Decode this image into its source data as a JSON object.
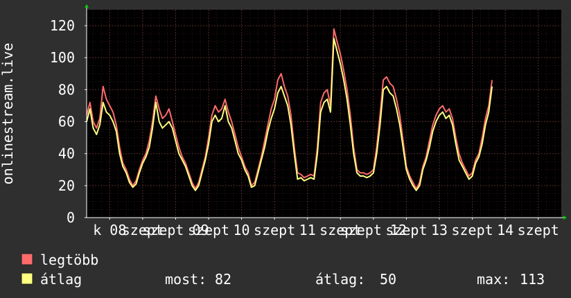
{
  "chart_data": {
    "type": "line",
    "ylabel": "onlinestream.live",
    "ylim": [
      0,
      130
    ],
    "yticks": [
      0,
      20,
      40,
      60,
      80,
      100,
      120
    ],
    "x_tick_labels": [
      "k 08",
      "szept",
      "szept 09",
      "szept",
      "10",
      "szept",
      "11",
      "szept",
      "szept 12",
      "szept",
      "13",
      "szept",
      "14",
      "szept"
    ],
    "x_tick_positions": [
      0,
      0.5,
      1.0,
      1.5,
      2.0,
      2.5,
      3.0,
      3.5,
      4.0,
      4.5,
      5.0,
      5.5,
      6.0,
      6.5
    ],
    "xlim": [
      -0.35,
      6.85
    ],
    "grid": true,
    "colors": {
      "background": "#2f2f2f",
      "canvas": "#000000",
      "grid": "#5a2a2a",
      "axis": "#ffffff",
      "max_series": "#ff6b6b",
      "avg_series": "#ffff80",
      "arrow": "#00cc00"
    },
    "x": [
      -0.35,
      -0.3,
      -0.25,
      -0.2,
      -0.15,
      -0.1,
      -0.05,
      0.0,
      0.05,
      0.1,
      0.15,
      0.2,
      0.25,
      0.3,
      0.35,
      0.4,
      0.45,
      0.5,
      0.55,
      0.6,
      0.65,
      0.7,
      0.75,
      0.8,
      0.85,
      0.9,
      0.95,
      1.0,
      1.05,
      1.1,
      1.15,
      1.2,
      1.25,
      1.3,
      1.35,
      1.4,
      1.45,
      1.5,
      1.55,
      1.6,
      1.65,
      1.7,
      1.75,
      1.8,
      1.85,
      1.9,
      1.95,
      2.0,
      2.05,
      2.1,
      2.15,
      2.2,
      2.25,
      2.3,
      2.35,
      2.4,
      2.45,
      2.5,
      2.55,
      2.6,
      2.65,
      2.7,
      2.75,
      2.8,
      2.85,
      2.9,
      2.95,
      3.0,
      3.05,
      3.1,
      3.15,
      3.2,
      3.25,
      3.3,
      3.35,
      3.4,
      3.45,
      3.5,
      3.55,
      3.6,
      3.65,
      3.7,
      3.75,
      3.8,
      3.85,
      3.9,
      3.95,
      4.0,
      4.05,
      4.1,
      4.15,
      4.2,
      4.25,
      4.3,
      4.35,
      4.4,
      4.45,
      4.5,
      4.55,
      4.6,
      4.65,
      4.7,
      4.75,
      4.8,
      4.85,
      4.9,
      4.95,
      5.0,
      5.05,
      5.1,
      5.15,
      5.2,
      5.25,
      5.3,
      5.35,
      5.4,
      5.45,
      5.5,
      5.55,
      5.6,
      5.65,
      5.7,
      5.75,
      5.8,
      5.85,
      5.9,
      5.95,
      6.0,
      6.05,
      6.1,
      6.15,
      6.2,
      6.25,
      6.3,
      6.35,
      6.4,
      6.45,
      6.5,
      6.55,
      6.6,
      6.65,
      6.7,
      6.75,
      6.8,
      6.85
    ],
    "series": [
      {
        "name": "legtöbb",
        "values": [
          64,
          72,
          60,
          56,
          62,
          82,
          74,
          70,
          66,
          58,
          44,
          34,
          30,
          24,
          20,
          23,
          30,
          36,
          40,
          48,
          60,
          76,
          68,
          62,
          64,
          68,
          60,
          52,
          44,
          38,
          34,
          28,
          22,
          18,
          22,
          30,
          38,
          50,
          64,
          70,
          66,
          68,
          74,
          66,
          60,
          52,
          44,
          38,
          32,
          28,
          20,
          22,
          30,
          38,
          48,
          58,
          68,
          74,
          86,
          90,
          82,
          76,
          64,
          44,
          28,
          27,
          25,
          26,
          27,
          26,
          44,
          72,
          78,
          80,
          70,
          118,
          110,
          102,
          92,
          80,
          64,
          44,
          30,
          28,
          28,
          27,
          28,
          30,
          44,
          64,
          86,
          88,
          84,
          82,
          74,
          64,
          48,
          32,
          26,
          22,
          18,
          22,
          32,
          38,
          48,
          58,
          64,
          68,
          70,
          66,
          68,
          62,
          50,
          40,
          34,
          30,
          26,
          28,
          36,
          40,
          50,
          62,
          70,
          86
        ],
        "sample_note": "shown"
      },
      {
        "name": "átlag",
        "values": [
          60,
          68,
          56,
          52,
          58,
          72,
          66,
          64,
          60,
          54,
          40,
          32,
          28,
          22,
          19,
          21,
          28,
          34,
          38,
          44,
          56,
          72,
          60,
          56,
          58,
          60,
          56,
          48,
          40,
          36,
          32,
          26,
          20,
          17,
          20,
          28,
          36,
          46,
          60,
          64,
          60,
          62,
          70,
          60,
          56,
          48,
          40,
          36,
          30,
          26,
          19,
          20,
          28,
          36,
          44,
          54,
          62,
          68,
          78,
          82,
          76,
          70,
          58,
          40,
          24,
          25,
          23,
          24,
          25,
          24,
          40,
          66,
          72,
          74,
          66,
          112,
          104,
          96,
          86,
          74,
          58,
          40,
          28,
          26,
          26,
          25,
          26,
          28,
          40,
          58,
          80,
          82,
          78,
          76,
          68,
          58,
          44,
          30,
          24,
          20,
          17,
          20,
          30,
          36,
          44,
          54,
          60,
          64,
          66,
          62,
          64,
          58,
          46,
          36,
          32,
          28,
          24,
          26,
          34,
          38,
          46,
          58,
          66,
          82
        ]
      }
    ],
    "legend": [
      {
        "key": "max",
        "label": "legtöbb"
      },
      {
        "key": "avg",
        "label": "átlag"
      }
    ],
    "stats": {
      "now_label": "most:",
      "now_value": "82",
      "avg_label": "átlag:",
      "avg_value": "50",
      "max_label": "max:",
      "max_value": "113"
    }
  }
}
